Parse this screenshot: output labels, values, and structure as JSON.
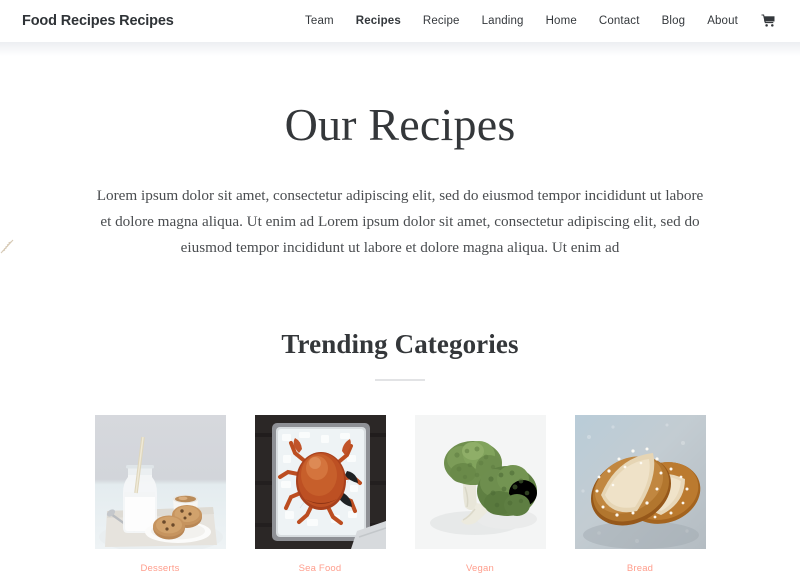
{
  "header": {
    "brand": "Food Recipes Recipes",
    "nav": [
      {
        "label": "Team",
        "active": false
      },
      {
        "label": "Recipes",
        "active": true
      },
      {
        "label": "Recipe",
        "active": false
      },
      {
        "label": "Landing",
        "active": false
      },
      {
        "label": "Home",
        "active": false
      },
      {
        "label": "Contact",
        "active": false
      },
      {
        "label": "Blog",
        "active": false
      },
      {
        "label": "About",
        "active": false
      }
    ],
    "cart_icon": "shopping-cart-icon"
  },
  "hero": {
    "title": "Our Recipes",
    "paragraph": "Lorem ipsum dolor sit amet, consectetur adipiscing elit, sed do eiusmod tempor incididunt ut labore et dolore magna aliqua. Ut enim ad Lorem ipsum dolor sit amet, consectetur adipiscing elit, sed do eiusmod tempor incididunt ut labore et dolore magna aliqua. Ut enim ad"
  },
  "section": {
    "title": "Trending Categories"
  },
  "categories": [
    {
      "label": "Desserts",
      "image": "milk-bottle-cookies-photo"
    },
    {
      "label": "Sea Food",
      "image": "crab-on-ice-photo"
    },
    {
      "label": "Vegan",
      "image": "broccoli-photo"
    },
    {
      "label": "Bread",
      "image": "pretzel-rolls-photo"
    }
  ],
  "colors": {
    "accent": "#ff9d8c",
    "text": "#34373a",
    "background": "#ffffff",
    "divider": "#e2e3e5"
  }
}
